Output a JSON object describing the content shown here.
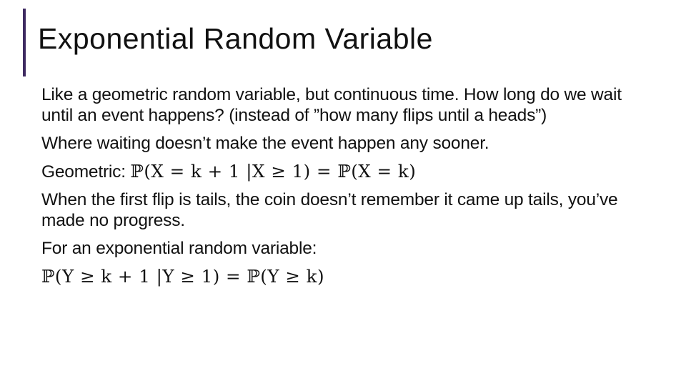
{
  "slide": {
    "title": "Exponential Random Variable",
    "accent_color": "#3e2a61",
    "paragraphs": [
      "Like a geometric random variable, but continuous time. How long do we wait until an event happens? (instead of ”how many flips until a heads”)",
      "Where waiting doesn’t make the event happen any sooner.",
      "When the first flip is tails, the coin doesn’t remember it came up tails, you’ve made no progress.",
      "For an exponential random variable:"
    ],
    "geometric_label": "Geometric: ",
    "geometric_formula": "ℙ(X = k + 1 |X ≥ 1) = ℙ(X = k)",
    "exponential_formula": "ℙ(Y ≥ k + 1 |Y ≥ 1) = ℙ(Y ≥ k)"
  }
}
